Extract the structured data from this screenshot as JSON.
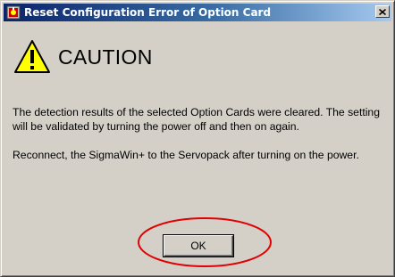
{
  "dialog": {
    "title": "Reset Configuration Error of Option Card",
    "close_symbol": "×",
    "icons": {
      "title_icon": "app-icon",
      "warning_icon": "warning-triangle-icon"
    },
    "caution_label": "CAUTION",
    "message_paragraph_1": "The detection results of the selected Option Cards were cleared. The setting will be validated by turning the power off and then on again.",
    "message_paragraph_2": "Reconnect, the SigmaWin+ to the Servopack after turning on the power.",
    "ok_label": "OK",
    "colors": {
      "title_gradient_start": "#0a246a",
      "title_gradient_end": "#a6caf0",
      "dialog_background": "#d4d0c8",
      "warning_fill": "#ffff00",
      "highlight_circle": "#e00000"
    }
  }
}
